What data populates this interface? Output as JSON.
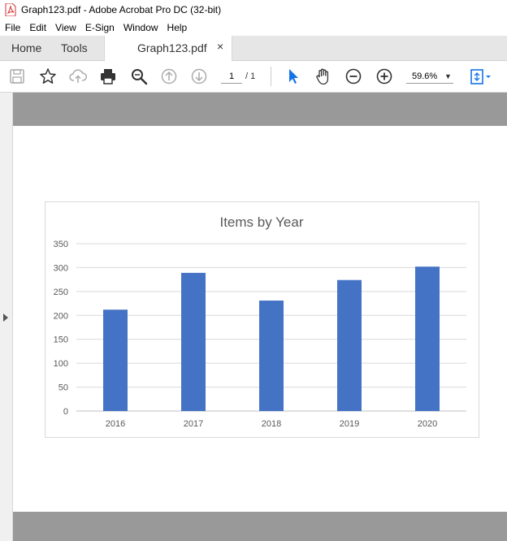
{
  "window": {
    "title": "Graph123.pdf - Adobe Acrobat Pro DC (32-bit)"
  },
  "menu": [
    "File",
    "Edit",
    "View",
    "E-Sign",
    "Window",
    "Help"
  ],
  "tabs": {
    "home": "Home",
    "tools": "Tools",
    "document": "Graph123.pdf",
    "close": "×"
  },
  "toolbar": {
    "page_current": "1",
    "page_total": "/ 1",
    "zoom": "59.6%"
  },
  "icons": [
    "save-icon",
    "bookmark-star-icon",
    "upload-cloud-icon",
    "print-icon",
    "find-magnifier-icon",
    "page-up-icon",
    "page-down-icon",
    "select-arrow-icon",
    "hand-tool-icon",
    "zoom-out-icon",
    "zoom-in-icon",
    "page-fit-icon"
  ],
  "colors": {
    "accent": "#1473e6",
    "bar": "#4472c4",
    "pdf_red": "#d72f2f"
  },
  "chart_data": {
    "type": "bar",
    "title": "Items by Year",
    "categories": [
      "2016",
      "2017",
      "2018",
      "2019",
      "2020"
    ],
    "values": [
      212,
      289,
      231,
      274,
      302
    ],
    "xlabel": "",
    "ylabel": "",
    "ylim": [
      0,
      350
    ],
    "yticks": [
      "0",
      "50",
      "100",
      "150",
      "200",
      "250",
      "300",
      "350"
    ],
    "grid": true,
    "legend": "none"
  }
}
